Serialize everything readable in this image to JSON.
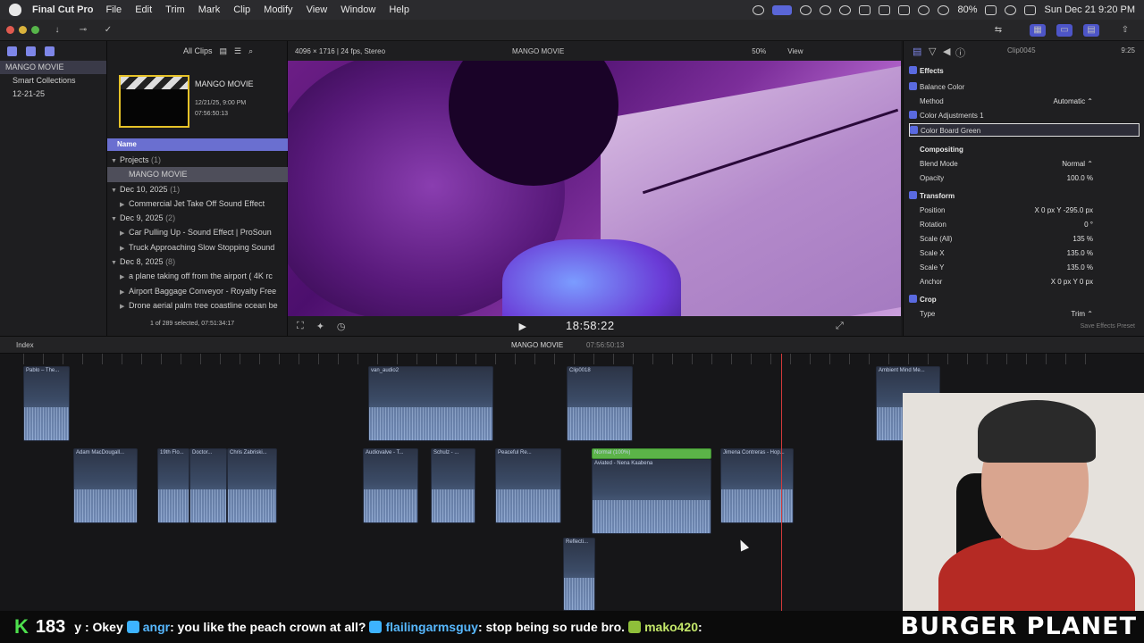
{
  "menubar": {
    "app_name": "Final Cut Pro",
    "menus": [
      "File",
      "Edit",
      "Trim",
      "Mark",
      "Clip",
      "Modify",
      "View",
      "Window",
      "Help"
    ],
    "battery": "80%",
    "datetime": "Sun Dec 21  9:20 PM"
  },
  "library": {
    "name": "MANGO MOVIE",
    "items": [
      {
        "label": "MANGO MOVIE"
      },
      {
        "label": "Smart Collections"
      },
      {
        "label": "12-21-25"
      }
    ]
  },
  "browser": {
    "filter": "All Clips",
    "thumb_title": "MANGO MOVIE",
    "thumb_date": "12/21/25, 9:00 PM",
    "thumb_duration": "07:56:50:13",
    "column_name": "Name",
    "rows": [
      {
        "tri": "▼",
        "label": "Projects",
        "count": "(1)"
      },
      {
        "tri": "",
        "label": "MANGO MOVIE",
        "count": ""
      },
      {
        "tri": "▼",
        "label": "Dec 10, 2025",
        "count": "(1)"
      },
      {
        "tri": "▶",
        "label": "Commercial Jet Take Off Sound Effect",
        "count": ""
      },
      {
        "tri": "▼",
        "label": "Dec 9, 2025",
        "count": "(2)"
      },
      {
        "tri": "▶",
        "label": "Car Pulling Up - Sound Effect  |  ProSoun",
        "count": ""
      },
      {
        "tri": "▶",
        "label": "Truck Approaching Slow Stopping Sound",
        "count": ""
      },
      {
        "tri": "▼",
        "label": "Dec 8, 2025",
        "count": "(8)"
      },
      {
        "tri": "▶",
        "label": "a plane taking off from the airport ( 4K rc",
        "count": ""
      },
      {
        "tri": "▶",
        "label": "Airport Baggage Conveyor - Royalty Free",
        "count": ""
      },
      {
        "tri": "▶",
        "label": "Drone aerial palm tree coastline ocean be",
        "count": ""
      }
    ],
    "status": "1 of 289 selected, 07:51:34:17"
  },
  "viewer": {
    "format": "4096 × 1716 | 24 fps, Stereo",
    "project": "MANGO MOVIE",
    "zoom": "50%",
    "view_label": "View",
    "timecode": "18:58:22"
  },
  "inspector": {
    "clip_name": "Clip0045",
    "duration": "9:25",
    "rows": [
      {
        "label": "Effects",
        "section": true,
        "chk": true,
        "val": "",
        "val2": ""
      },
      {
        "label": "Balance Color",
        "section": false,
        "chk": true,
        "val": "",
        "val2": ""
      },
      {
        "label": "Method",
        "section": false,
        "chk": false,
        "val": "Automatic ⌃",
        "val2": ""
      },
      {
        "label": "Color Adjustments 1",
        "section": false,
        "chk": true,
        "val": "",
        "val2": ""
      },
      {
        "label": "Color Board Green",
        "section": false,
        "chk": true,
        "val": "",
        "val2": "",
        "boxed": true
      },
      {
        "label": "Compositing",
        "section": true,
        "chk": false,
        "val": "",
        "val2": ""
      },
      {
        "label": "Blend Mode",
        "section": false,
        "chk": false,
        "val": "Normal ⌃",
        "val2": ""
      },
      {
        "label": "Opacity",
        "section": false,
        "chk": false,
        "val": "100.0 %",
        "val2": ""
      },
      {
        "label": "Transform",
        "section": true,
        "chk": true,
        "val": "",
        "val2": ""
      },
      {
        "label": "Position",
        "section": false,
        "chk": false,
        "val": "X  0 px  Y  -295.0 px",
        "val2": ""
      },
      {
        "label": "Rotation",
        "section": false,
        "chk": false,
        "val": "0 °",
        "val2": ""
      },
      {
        "label": "Scale (All)",
        "section": false,
        "chk": false,
        "val": "135 %",
        "val2": ""
      },
      {
        "label": "Scale X",
        "section": false,
        "chk": false,
        "val": "135.0 %",
        "val2": ""
      },
      {
        "label": "Scale Y",
        "section": false,
        "chk": false,
        "val": "135.0 %",
        "val2": ""
      },
      {
        "label": "Anchor",
        "section": false,
        "chk": false,
        "val": "X  0 px  Y  0 px",
        "val2": ""
      },
      {
        "label": "Crop",
        "section": true,
        "chk": true,
        "val": "",
        "val2": ""
      },
      {
        "label": "Type",
        "section": false,
        "chk": false,
        "val": "Trim ⌃",
        "val2": ""
      }
    ],
    "save_preset": "Save Effects Preset"
  },
  "timeline_bar": {
    "index": "Index",
    "project": "MANGO MOVIE",
    "timecode": "07:56:50:13"
  },
  "timeline": {
    "clips": [
      {
        "name": "Pablo – The..."
      },
      {
        "name": "van_audio2"
      },
      {
        "name": "Clip0018"
      },
      {
        "name": "Adam MacDougall..."
      },
      {
        "name": "19th Flo..."
      },
      {
        "name": "Doctor..."
      },
      {
        "name": "Chris Zabriski..."
      },
      {
        "name": "Audiovalve - T..."
      },
      {
        "name": "Schulz - ..."
      },
      {
        "name": "Peaceful Re..."
      },
      {
        "name": "Normal (100%)"
      },
      {
        "name": "Aviated - Nena Kaabena"
      },
      {
        "name": "Jimena Contreras - Hop..."
      },
      {
        "name": "Reflecti..."
      },
      {
        "name": "Chopin - E Min..."
      },
      {
        "name": "Ambient Mind Me..."
      }
    ]
  },
  "ticker": {
    "badge_count": "183",
    "msg1": "y : Okey",
    "user1": "angr",
    "msg2": ": you like the peach crown at all?",
    "user2": "flailingarmsguy",
    "msg3": ": stop being so rude bro.",
    "user3": "mako420",
    "msg4": ":",
    "brand": "BURGER PLANET"
  }
}
